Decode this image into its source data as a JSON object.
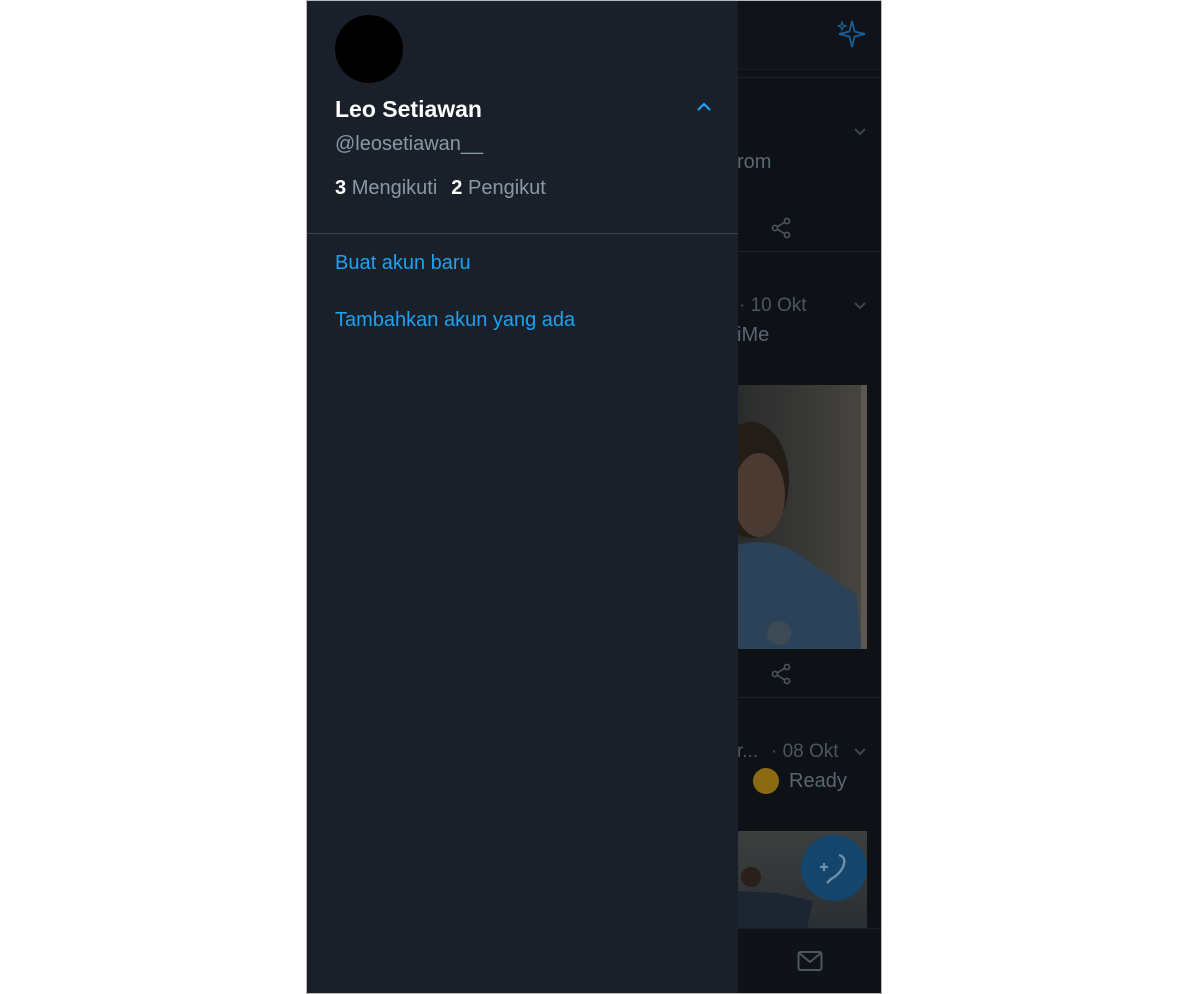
{
  "drawer": {
    "name": "Leo Setiawan",
    "handle": "@leosetiawan__",
    "following_count": "3",
    "following_label": "Mengikuti",
    "followers_count": "2",
    "followers_label": "Pengikut",
    "links": [
      "Buat akun baru",
      "Tambahkan akun yang ada"
    ]
  },
  "timeline": {
    "tweet1_text": "rom",
    "tweet2_date": "· 10 Okt",
    "tweet2_text": "iMe",
    "tweet3_name": "r...",
    "tweet3_date": "· 08 Okt",
    "tweet3_text": "Ready"
  },
  "colors": {
    "drawer_bg": "#1a202a",
    "link": "#1da1f2",
    "accent": "#1da1f2"
  },
  "icons": [
    "sparkle-icon",
    "chevron-up-icon",
    "chevron-down-icon",
    "share-icon",
    "compose-tweet-icon",
    "mail-icon"
  ]
}
